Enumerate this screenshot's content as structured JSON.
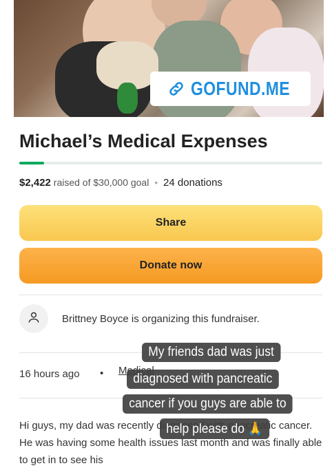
{
  "campaign": {
    "badge_text": "GOFUND.ME",
    "title": "Michael’s Medical Expenses",
    "raised": "$2,422",
    "raised_of_text": "raised of $30,000 goal",
    "separator": "•",
    "donations": "24 donations",
    "progress_fraction": 0.081
  },
  "buttons": {
    "share_label": "Share",
    "donate_label": "Donate now"
  },
  "organizer": {
    "text": "Brittney Boyce is organizing this fundraiser."
  },
  "meta": {
    "time": "16 hours ago",
    "bullet": "•",
    "category": "Medical"
  },
  "story": {
    "text": "Hi guys, my dad was recently diagnosed with pancreatic cancer. He was having some health issues last month and was finally able to get in to see his"
  },
  "overlay": {
    "lines": [
      "My friends dad was just",
      "diagnosed with pancreatic",
      "cancer if you guys are able to",
      "help please do 🙏"
    ]
  },
  "colors": {
    "brand_green": "#02a95c",
    "badge_blue": "#1f8fe0",
    "share_yellow": "#f9c74f",
    "donate_orange": "#f59a23"
  }
}
